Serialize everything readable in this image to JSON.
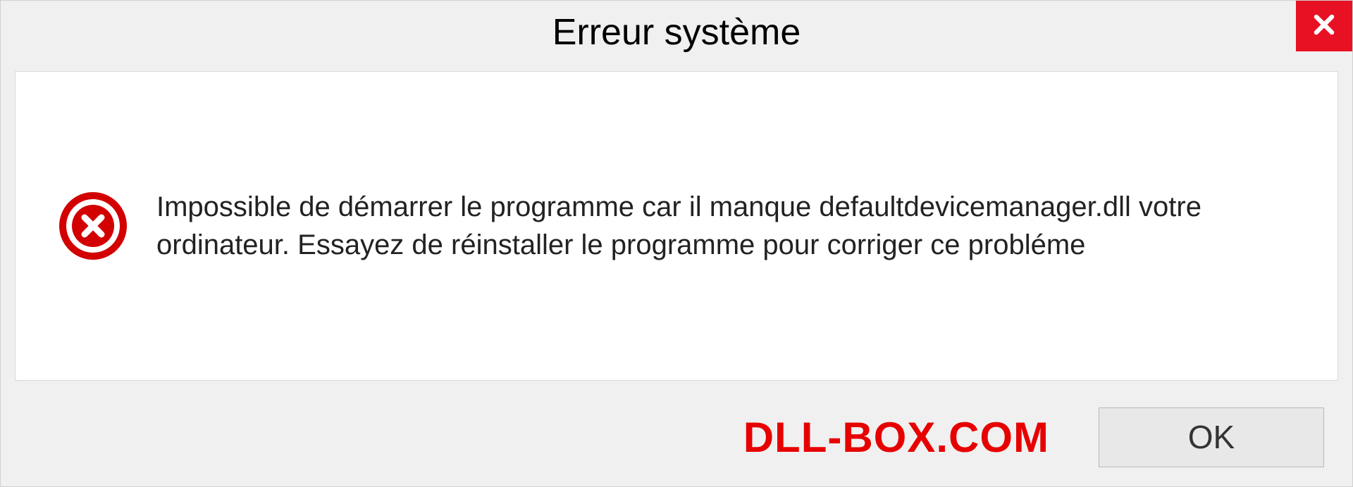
{
  "dialog": {
    "title": "Erreur système",
    "message": "Impossible de démarrer le programme car il manque defaultdevicemanager.dll votre ordinateur. Essayez de réinstaller le programme pour corriger ce probléme",
    "watermark": "DLL-BOX.COM",
    "ok_label": "OK",
    "colors": {
      "close_bg": "#e81123",
      "error_icon": "#d20000",
      "watermark": "#e60000"
    }
  }
}
